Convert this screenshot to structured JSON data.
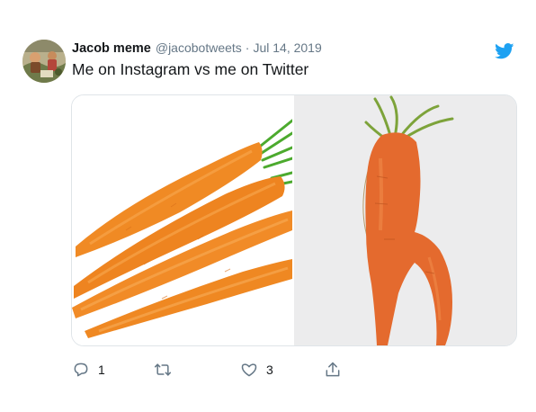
{
  "author": {
    "display_name": "Jacob meme",
    "handle": "@jacobotweets",
    "separator": "·",
    "date": "Jul 14, 2019",
    "avatar_icon": "avatar"
  },
  "tweet": {
    "text": "Me on Instagram vs me on Twitter"
  },
  "media": {
    "left_image": "carrots-photo",
    "right_image": "odd-carrot-photo"
  },
  "actions": {
    "reply_count": "1",
    "retweet_count": "",
    "like_count": "3",
    "share_count": ""
  },
  "colors": {
    "twitter_blue": "#1da1f2",
    "secondary_text": "#657786",
    "icon_gray": "#657786",
    "carrot_orange": "#f08a24"
  }
}
